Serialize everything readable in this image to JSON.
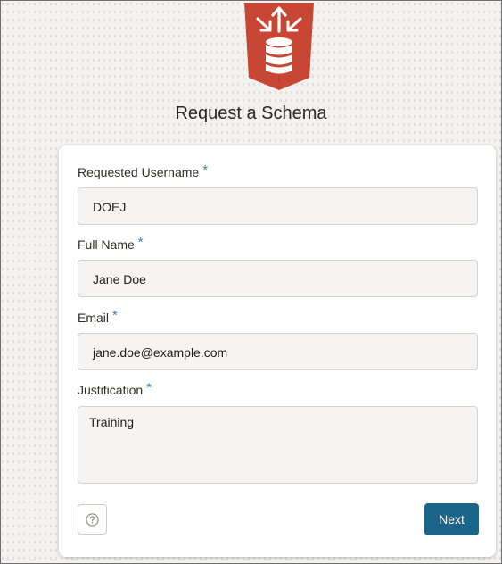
{
  "app": {
    "title": "Request a Schema",
    "logo_icon": "database-arrows-shield-icon",
    "brand_color": "#c74634"
  },
  "form": {
    "required_marker": "*",
    "fields": [
      {
        "label": "Requested Username",
        "value": "DOEJ"
      },
      {
        "label": "Full Name",
        "value": "Jane Doe"
      },
      {
        "label": "Email",
        "value": "jane.doe@example.com"
      },
      {
        "label": "Justification",
        "value": "Training"
      }
    ]
  },
  "actions": {
    "help_icon": "question-circle-icon",
    "next_label": "Next",
    "next_color": "#1b6589"
  }
}
